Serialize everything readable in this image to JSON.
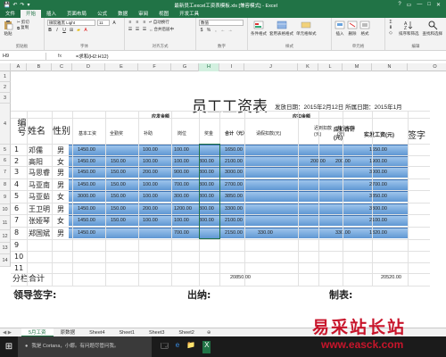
{
  "window": {
    "title": "最新员工excel工资表模板.xls [兼容模式] - Excel",
    "qat": [
      "💾",
      "↶",
      "↷",
      "▾"
    ],
    "controls": [
      "?",
      "▭",
      "—",
      "□",
      "✕"
    ]
  },
  "ribbon_tabs": [
    "文件",
    "开始",
    "插入",
    "页面布局",
    "公式",
    "数据",
    "审阅",
    "视图",
    "开发工具"
  ],
  "ribbon": {
    "paste_label": "粘贴",
    "cut_label": "剪切",
    "copy_label": "复制",
    "clipboard_label": "剪贴板",
    "font_name": "微软雅黑 Light",
    "font_size": "11",
    "font_group_label": "字体",
    "wrap_label": "自动换行",
    "merge_label": "合并后居中",
    "align_group_label": "对齐方式",
    "number_format": "数值",
    "number_group_label": "数字",
    "cond_format_label": "条件格式",
    "table_format_label": "套用表格格式",
    "cell_style_label": "单元格样式",
    "style_group_label": "样式",
    "insert_label": "插入",
    "delete_label": "删除",
    "format_label": "格式",
    "cells_group_label": "单元格",
    "sort_label": "排序和筛选",
    "find_label": "查找和选择",
    "edit_group_label": "编辑"
  },
  "formula_bar": {
    "name_box": "H9",
    "fx": "fx",
    "formula": "=求和(H2:H12)"
  },
  "columns": [
    "A",
    "B",
    "C",
    "D",
    "E",
    "F",
    "G",
    "H",
    "I",
    "J",
    "K",
    "L",
    "M",
    "N",
    "O"
  ],
  "rows": [
    "1",
    "2",
    "3",
    "4",
    "5",
    "6",
    "7",
    "8",
    "9",
    "10",
    "11",
    "12",
    "13",
    "14"
  ],
  "sheet": {
    "title": "员工工资表",
    "issue_date": "发放日期：2015年2月12日 所属日期：2015年1月",
    "header_pay_items": "应发金额",
    "header_deduct_items": "应扣金额",
    "col_no": "编号",
    "col_name": "姓名",
    "col_gender": "性别",
    "col_base": "基本工资",
    "col_overtime": "全勤奖",
    "col_subsidy": "补助",
    "col_post": "岗位",
    "col_bonus": "奖金",
    "col_total": "合计（元）",
    "col_leave": "请假扣款(元)",
    "col_late": "迟到扣款(元)",
    "col_other": "其它扣款(元)",
    "col_deduct_total": "应扣合计(元)",
    "col_actual": "实发工资(元)",
    "col_sign": "签字",
    "employees": [
      {
        "no": "1",
        "name": "邓儒",
        "gender": "男",
        "base": "1450.00",
        "full": "",
        "sub": "100.00",
        "post": "100.00",
        "bonus": "",
        "total": "1650.00",
        "leave": "",
        "late": "",
        "other": "",
        "deduct": "",
        "actual": "1650.00"
      },
      {
        "no": "2",
        "name": "高阳",
        "gender": "女",
        "base": "1450.00",
        "full": "150.00",
        "sub": "100.00",
        "post": "100.00",
        "bonus": "300.00",
        "total": "2100.00",
        "leave": "",
        "late": "",
        "other": "200.00",
        "deduct": "200.00",
        "actual": "1900.00"
      },
      {
        "no": "3",
        "name": "马思睿",
        "gender": "男",
        "base": "1450.00",
        "full": "150.00",
        "sub": "200.00",
        "post": "900.00",
        "bonus": "300.00",
        "total": "3000.00",
        "leave": "",
        "late": "",
        "other": "",
        "deduct": "",
        "actual": "3000.00"
      },
      {
        "no": "4",
        "name": "马亚南",
        "gender": "男",
        "base": "1450.00",
        "full": "150.00",
        "sub": "100.00",
        "post": "700.00",
        "bonus": "300.00",
        "total": "2700.00",
        "leave": "",
        "late": "",
        "other": "",
        "deduct": "",
        "actual": "2700.00"
      },
      {
        "no": "5",
        "name": "马亚茹",
        "gender": "女",
        "base": "3000.00",
        "full": "150.00",
        "sub": "100.00",
        "post": "300.00",
        "bonus": "300.00",
        "total": "3850.00",
        "leave": "",
        "late": "",
        "other": "",
        "deduct": "",
        "actual": "3850.00"
      },
      {
        "no": "6",
        "name": "王卫明",
        "gender": "男",
        "base": "1450.00",
        "full": "150.00",
        "sub": "200.00",
        "post": "1200.00",
        "bonus": "300.00",
        "total": "3300.00",
        "leave": "",
        "late": "",
        "other": "",
        "deduct": "",
        "actual": "3300.00"
      },
      {
        "no": "7",
        "name": "张娅琴",
        "gender": "女",
        "base": "1450.00",
        "full": "150.00",
        "sub": "100.00",
        "post": "100.00",
        "bonus": "300.00",
        "total": "2100.00",
        "leave": "",
        "late": "",
        "other": "",
        "deduct": "",
        "actual": "2100.00"
      },
      {
        "no": "8",
        "name": "郑国斌",
        "gender": "男",
        "base": "1450.00",
        "full": "",
        "sub": "",
        "post": "700.00",
        "bonus": "",
        "total": "2150.00",
        "leave": "330.00",
        "late": "",
        "other": "",
        "deduct": "330.00",
        "actual": "1820.00"
      }
    ],
    "blank_rows": [
      "9",
      "10",
      "11"
    ],
    "subtotal_label": "分栏合计",
    "subtotal_total": "20850.00",
    "subtotal_actual": "20520.00",
    "sign_leader": "领导签字:",
    "sign_cashier": "出纳:",
    "sign_maker": "制表:"
  },
  "sheet_tabs": [
    "5月工资",
    "原数据",
    "Sheet4",
    "Sheet1",
    "Sheet3",
    "Sheet2"
  ],
  "sheet_nav": "◀ ▶",
  "sheet_add": "⊕",
  "taskbar": {
    "start": "⊞",
    "search_placeholder": "我是 Cortana，小娜。有问题尽管问我。",
    "icons": [
      "🗔",
      "e",
      "📁",
      "X"
    ]
  },
  "watermark": {
    "cn": "易采站长站",
    "en": "www.easck.com"
  },
  "colors": {
    "excel_green": "#217346",
    "band_blue": "#5f97d3",
    "watermark_red": "#c8152b"
  }
}
